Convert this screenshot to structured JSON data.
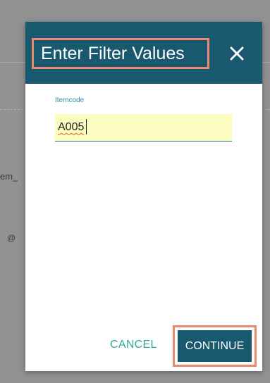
{
  "dialog": {
    "title": "Enter Filter Values",
    "close_icon": "close-icon"
  },
  "background": {
    "fragment_1": "em_",
    "fragment_2": "@"
  },
  "field": {
    "label": "Itemcode",
    "value": "A005"
  },
  "actions": {
    "cancel_label": "CANCEL",
    "continue_label": "CONTINUE"
  },
  "colors": {
    "header": "#18596f",
    "highlight_outline": "#e98a6c",
    "input_background": "#fbfcc0",
    "label_accent": "#2a8fa5",
    "cancel_text": "#2ea8a0"
  }
}
